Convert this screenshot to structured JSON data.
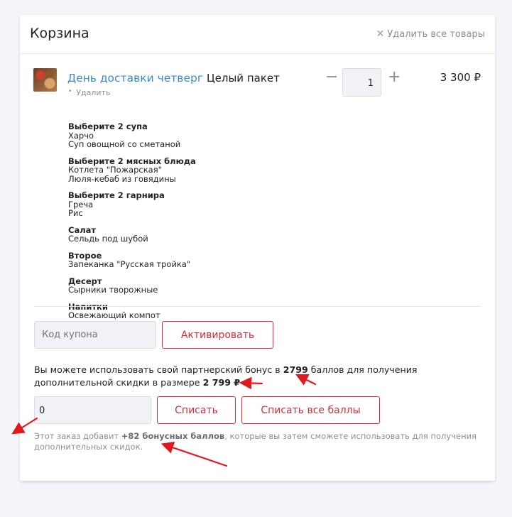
{
  "header": {
    "title": "Корзина",
    "clear_all_label": "Удалить все товары"
  },
  "item": {
    "name": "День доставки четверг",
    "variant": "Целый пакет",
    "remove_label": "Удалить",
    "quantity": "1",
    "price": "3 300 ₽",
    "groups": [
      {
        "title": "Выберите 2 супа",
        "options": [
          "Харчо",
          "Суп овощной со сметаной"
        ]
      },
      {
        "title": "Выберите 2 мясных блюда",
        "options": [
          "Котлета \"Пожарская\"",
          "Люля-кебаб из говядины"
        ]
      },
      {
        "title": "Выберите 2 гарнира",
        "options": [
          "Греча",
          "Рис"
        ]
      },
      {
        "title": "Салат",
        "options": [
          "Сельдь под шубой"
        ]
      },
      {
        "title": "Второе",
        "options": [
          "Запеканка \"Русская тройка\""
        ]
      },
      {
        "title": "Десерт",
        "options": [
          "Сырники творожные"
        ]
      },
      {
        "title": "Напитки",
        "options": [
          "Освежающий компот"
        ]
      }
    ]
  },
  "coupon": {
    "placeholder": "Код купона",
    "activate_label": "Активировать"
  },
  "bonus": {
    "text_1": "Вы можете использовать свой партнерский бонус в ",
    "points": "2799",
    "text_2": " баллов для получения дополнительной скидки в размере ",
    "amount": "2 799 ₽",
    "input_value": "0",
    "spend_label": "Списать",
    "spend_all_label": "Списать все баллы"
  },
  "earn": {
    "text_1": "Этот заказ добавит ",
    "bonus": "+82 бонусных баллов",
    "text_2": ", которые вы затем сможете использовать для получения дополнительных скидок."
  },
  "colors": {
    "accent_red": "#c8323a",
    "link_blue": "#3e8bc6",
    "annotation_arrow": "#e3181f"
  }
}
